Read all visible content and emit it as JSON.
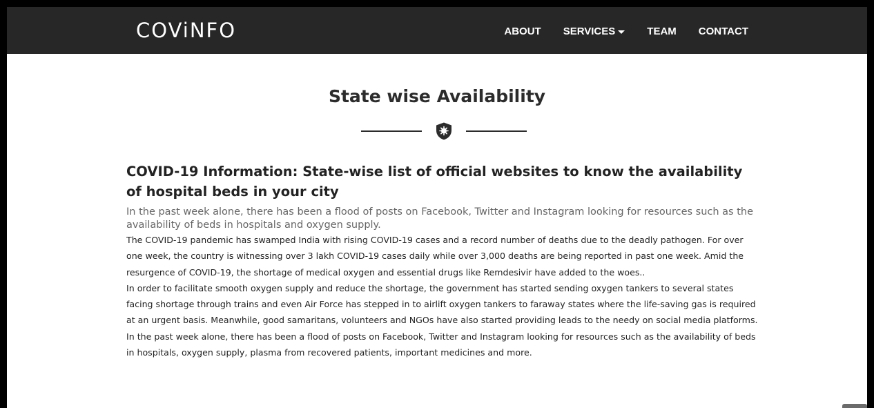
{
  "navbar": {
    "brand": "COViNFO",
    "items": [
      {
        "label": "ABOUT"
      },
      {
        "label": "SERVICES"
      },
      {
        "label": "TEAM"
      },
      {
        "label": "CONTACT"
      }
    ]
  },
  "section": {
    "title": "State wise Availability"
  },
  "article": {
    "heading": "COVID-19 Information: State-wise list of official websites to know the availability of hospital beds in your city",
    "lead": "In the past week alone, there has been a flood of posts on Facebook, Twitter and Instagram looking for resources such as the availability of beds in hospitals and oxygen supply.",
    "paragraphs": [
      "The COVID-19 pandemic has swamped India with rising COVID-19 cases and a record number of deaths due to the deadly pathogen. For over one week, the country is witnessing over 3 lakh COVID-19 cases daily while over 3,000 deaths are being reported in past one week. Amid the resurgence of COVID-19, the shortage of medical oxygen and essential drugs like Remdesivir have added to the woes..",
      "In order to facilitate smooth oxygen supply and reduce the shortage, the government has started sending oxygen tankers to several states facing shortage through trains and even Air Force has stepped in to airlift oxygen tankers to faraway states where the life-saving gas is required at an urgent basis. Meanwhile, good samaritans, volunteers and NGOs have also started providing leads to the needy on social media platforms. In the past week alone, there has been a flood of posts on Facebook, Twitter and Instagram looking for resources such as the availability of beds in hospitals, oxygen supply, plasma from recovered patients, important medicines and more."
    ]
  },
  "colors": {
    "navbar_bg": "#272727",
    "text_dark": "#222222",
    "text_muted": "#666666"
  },
  "icons": {
    "divider": "shield-virus-icon",
    "services_dropdown": "caret-down-icon",
    "scroll_top": "scroll-top-icon"
  }
}
